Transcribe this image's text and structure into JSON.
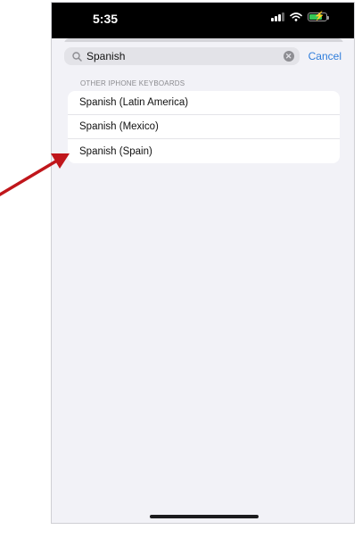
{
  "status_bar": {
    "time": "5:35",
    "signal_icon": "cellular-signal-icon",
    "wifi_icon": "wifi-icon",
    "battery_icon": "battery-charging-icon",
    "battery_color": "#34c759"
  },
  "search": {
    "value": "Spanish",
    "icon": "search-icon",
    "clear_icon": "clear-icon",
    "cancel_label": "Cancel",
    "accent_color": "#2f7ddb"
  },
  "section": {
    "header": "OTHER IPHONE KEYBOARDS",
    "items": [
      {
        "label": "Spanish (Latin America)"
      },
      {
        "label": "Spanish (Mexico)"
      },
      {
        "label": "Spanish (Spain)"
      }
    ]
  },
  "annotation": {
    "arrow_color": "#c0161b",
    "arrow_icon": "annotation-arrow-icon"
  }
}
